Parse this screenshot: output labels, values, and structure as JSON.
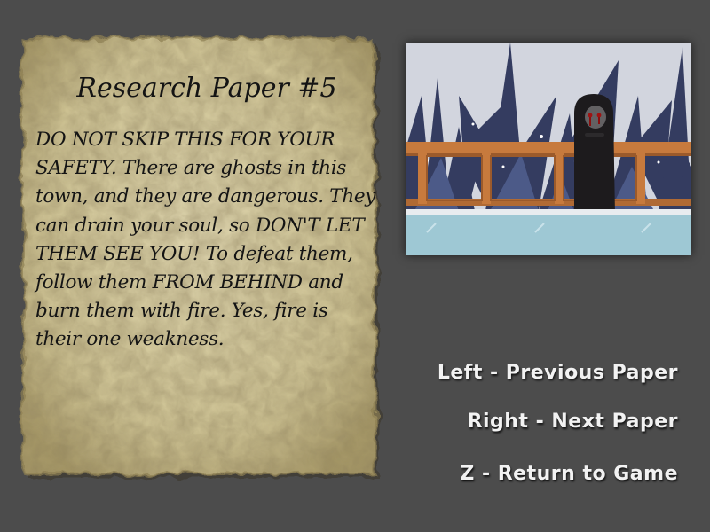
{
  "paper": {
    "title": "Research Paper #5",
    "body": "DO NOT SKIP THIS FOR YOUR SAFETY. There are ghosts in this town, and they are dangerous. They can drain your soul, so DON'T LET THEM SEE YOU! To defeat them, follow them FROM BEHIND and burn them with fire. Yes, fire is their one weakness."
  },
  "controls": {
    "left": "Left - Previous Paper",
    "right": "Right - Next Paper",
    "z": "Z - Return to Game"
  },
  "colors": {
    "background": "#4c4c4c",
    "paper": "#d9cfa4",
    "text": "#141414",
    "control_text": "#f2f2f2"
  }
}
